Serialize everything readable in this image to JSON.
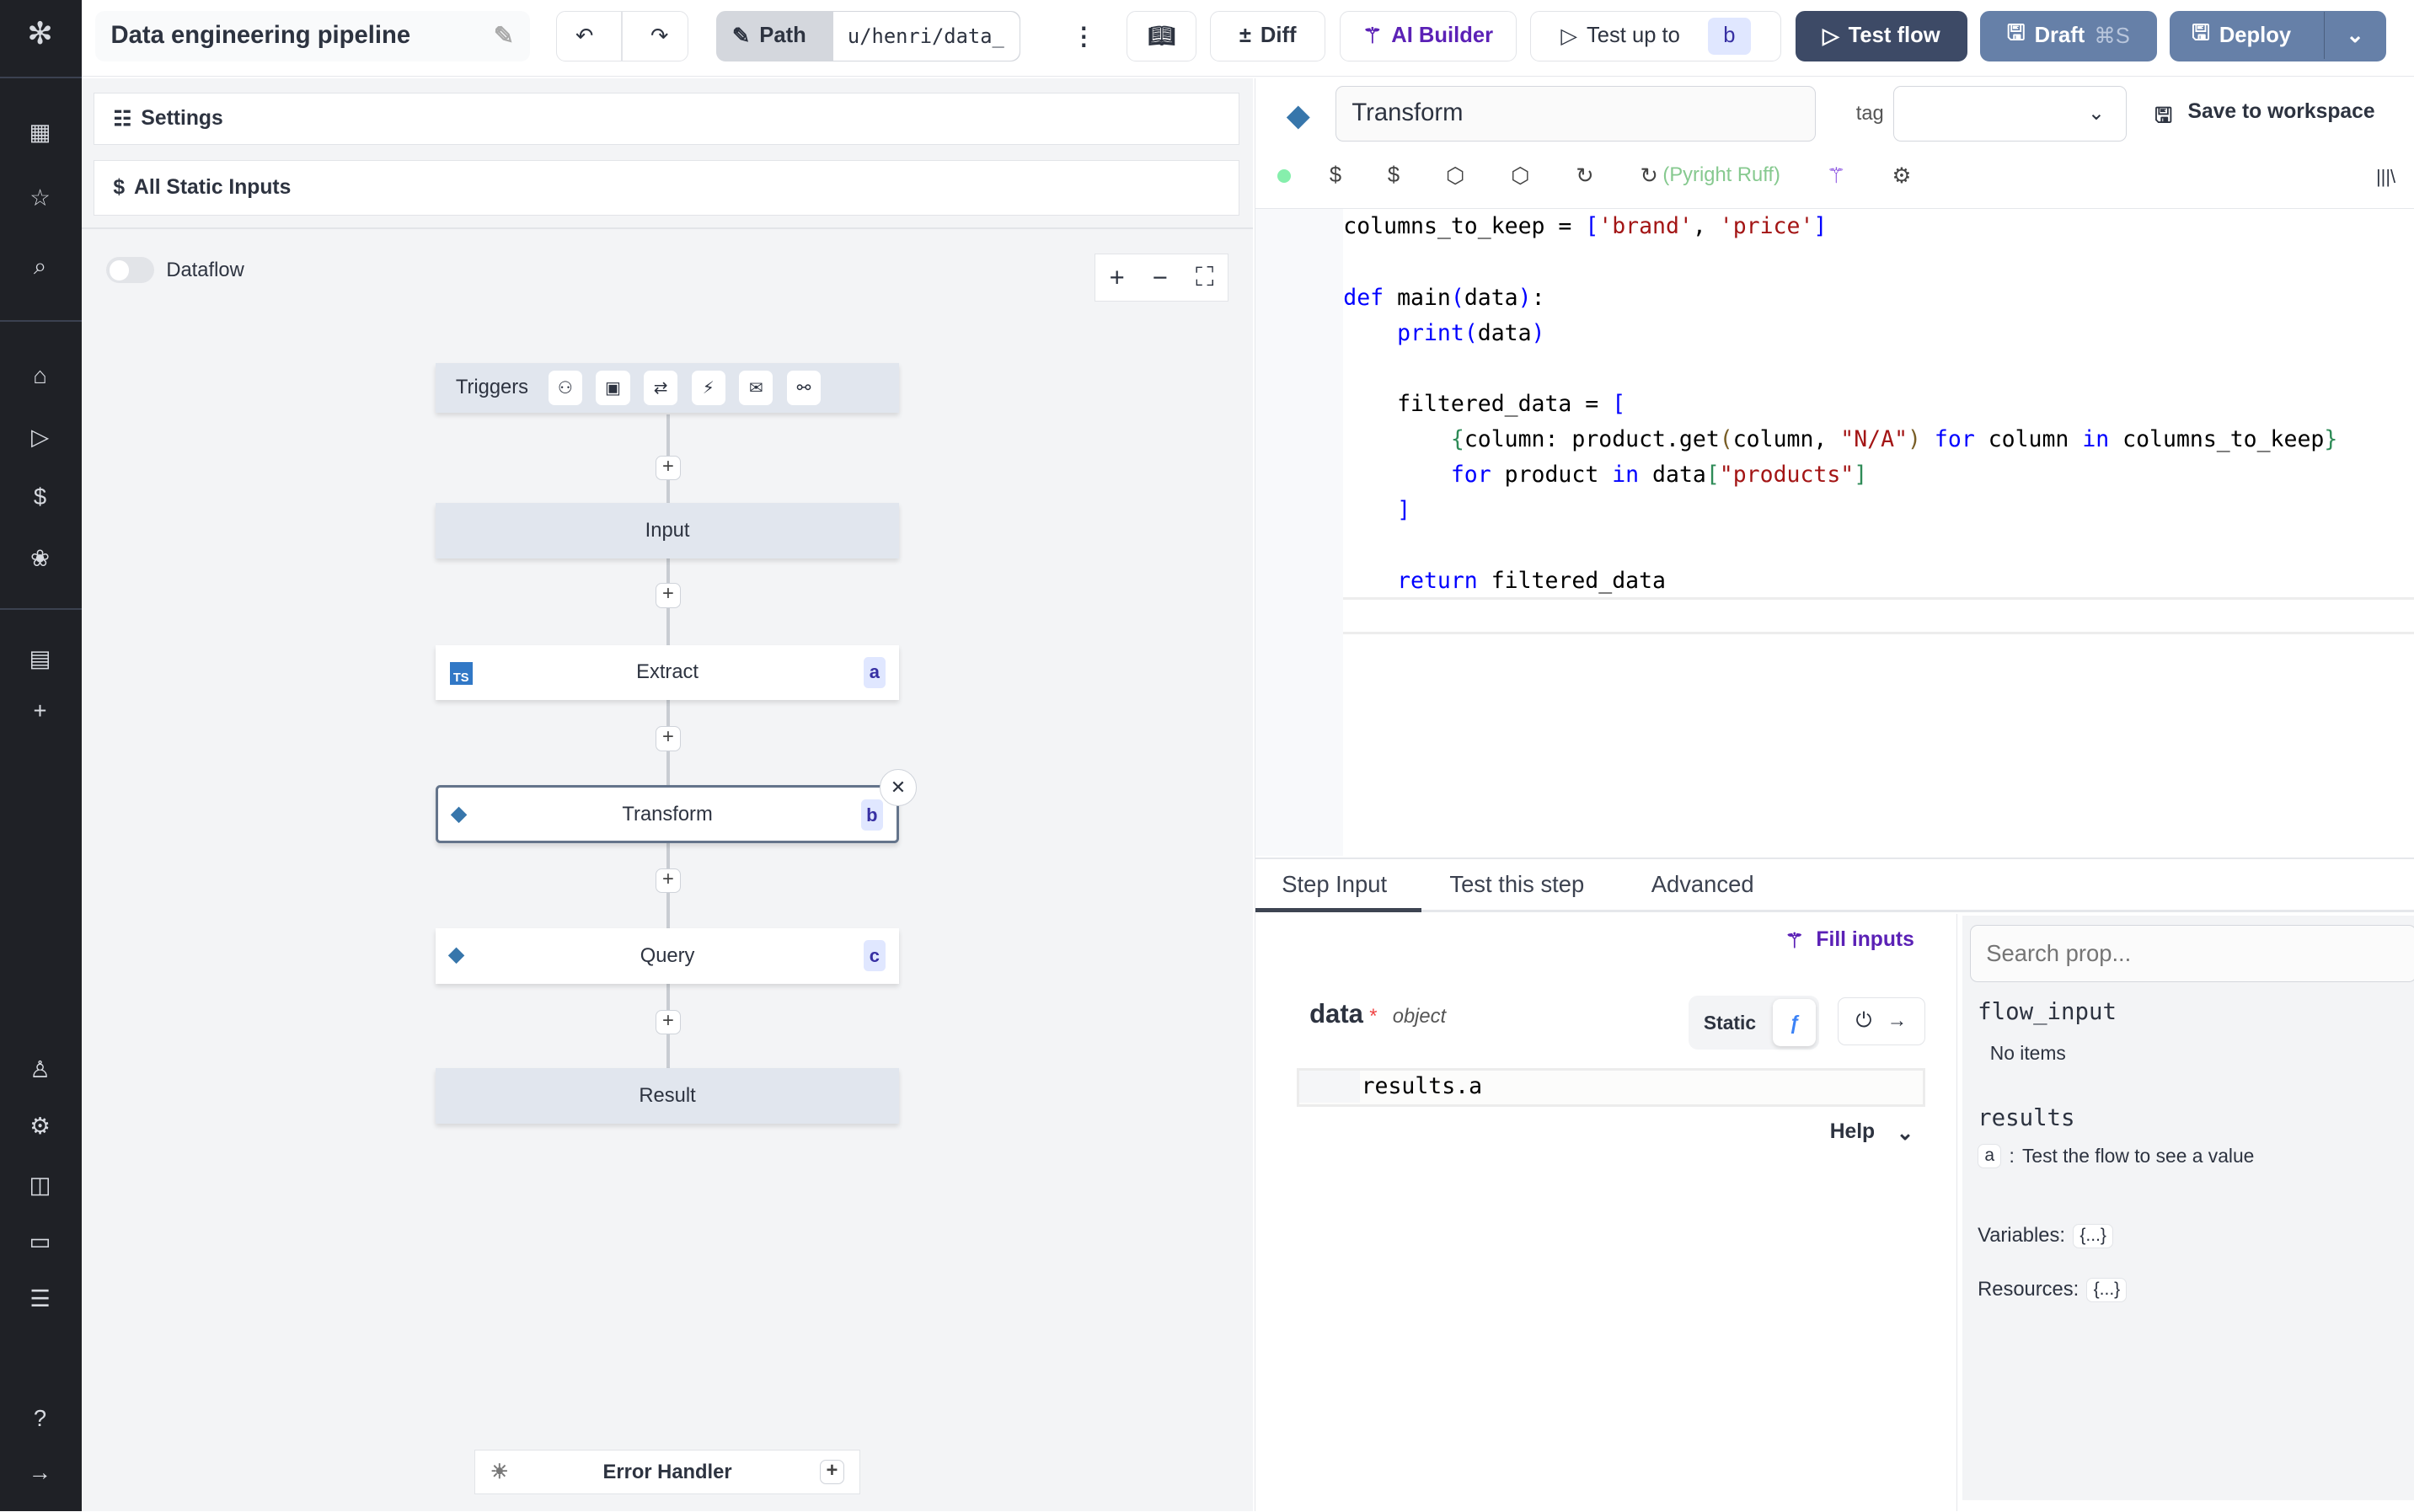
{
  "header": {
    "title": "Data engineering pipeline",
    "path_label": "Path",
    "path_value": "u/henri/data_",
    "diff": "Diff",
    "ai_builder": "AI Builder",
    "test_up_to": "Test up to",
    "test_up_to_step": "b",
    "test_flow": "Test flow",
    "draft": "Draft",
    "draft_shortcut": "⌘S",
    "deploy": "Deploy"
  },
  "sidebar": {
    "icons": [
      "windmill-logo",
      "dashboard-icon",
      "star-icon",
      "search-icon",
      "home-icon",
      "play-icon",
      "dollar-icon",
      "resources-icon",
      "calendar-icon",
      "plus-icon",
      "user-icon",
      "gear-icon",
      "bot-icon",
      "folder-icon",
      "list-icon",
      "help-icon",
      "expand-icon"
    ]
  },
  "left": {
    "settings": "Settings",
    "static_inputs": "All Static Inputs",
    "dataflow": "Dataflow",
    "dataflow_on": false,
    "triggers_label": "Triggers",
    "trigger_icons": [
      "webhook-icon",
      "schedule-icon",
      "http-route-icon",
      "websocket-icon",
      "email-icon",
      "kafka-icon"
    ],
    "nodes": [
      {
        "label": "Input"
      },
      {
        "label": "Extract",
        "id": "a",
        "lang": "TS"
      },
      {
        "label": "Transform",
        "id": "b",
        "lang": "python"
      },
      {
        "label": "Query",
        "id": "c",
        "lang": "python"
      },
      {
        "label": "Result"
      }
    ],
    "error_handler": "Error Handler"
  },
  "editor": {
    "step_name": "Transform",
    "tag_label": "tag",
    "tag_value": "",
    "save_to_workspace": "Save to workspace",
    "lsp": "Pyright Ruff",
    "status_color": "#86efac",
    "code": [
      [
        [
          "columns_to_keep = ",
          ""
        ],
        [
          "[",
          "k"
        ],
        [
          "'brand'",
          "s"
        ],
        [
          ", ",
          ""
        ],
        [
          "'price'",
          "s"
        ],
        [
          "]",
          "k"
        ]
      ],
      [],
      [
        [
          "def",
          "k"
        ],
        [
          " main",
          ""
        ],
        [
          "(",
          "k"
        ],
        [
          "data",
          ""
        ],
        [
          ")",
          "k"
        ],
        [
          ":",
          ""
        ]
      ],
      [
        [
          "    ",
          ""
        ],
        [
          "print",
          "k"
        ],
        [
          "(",
          "k"
        ],
        [
          "data",
          ""
        ],
        [
          ")",
          "k"
        ]
      ],
      [],
      [
        [
          "    filtered_data = ",
          ""
        ],
        [
          "[",
          "k"
        ]
      ],
      [
        [
          "        ",
          ""
        ],
        [
          "{",
          "g"
        ],
        [
          "column: product.get",
          ""
        ],
        [
          "(",
          "br"
        ],
        [
          "column, ",
          ""
        ],
        [
          "\"N/A\"",
          "s"
        ],
        [
          ")",
          "br"
        ],
        [
          " for",
          "k"
        ],
        [
          " column ",
          ""
        ],
        [
          "in",
          "k"
        ],
        [
          " columns_to_keep",
          ""
        ],
        [
          "}",
          "g"
        ]
      ],
      [
        [
          "        ",
          ""
        ],
        [
          "for",
          "k"
        ],
        [
          " product ",
          ""
        ],
        [
          "in",
          "k"
        ],
        [
          " data",
          ""
        ],
        [
          "[",
          "g"
        ],
        [
          "\"products\"",
          "s"
        ],
        [
          "]",
          "g"
        ]
      ],
      [
        [
          "    ",
          ""
        ],
        [
          "]",
          "k"
        ]
      ],
      [],
      [
        [
          "    ",
          ""
        ],
        [
          "return",
          "k"
        ],
        [
          " filtered_data",
          ""
        ]
      ]
    ]
  },
  "bottom": {
    "tabs": [
      "Step Input",
      "Test this step",
      "Advanced"
    ],
    "active_tab": 0,
    "fill_inputs": "Fill inputs",
    "arg_name": "data",
    "arg_required": "*",
    "arg_type": "object",
    "static": "Static",
    "arg_value": "results.a",
    "help": "Help",
    "search_placeholder": "Search prop...",
    "flow_input": "flow_input",
    "no_items": "No items",
    "results": "results",
    "result_key": "a",
    "result_sep": ":",
    "result_text": "Test the flow to see a value",
    "variables": "Variables:",
    "resources": "Resources:",
    "ellipsis": "{...}"
  }
}
